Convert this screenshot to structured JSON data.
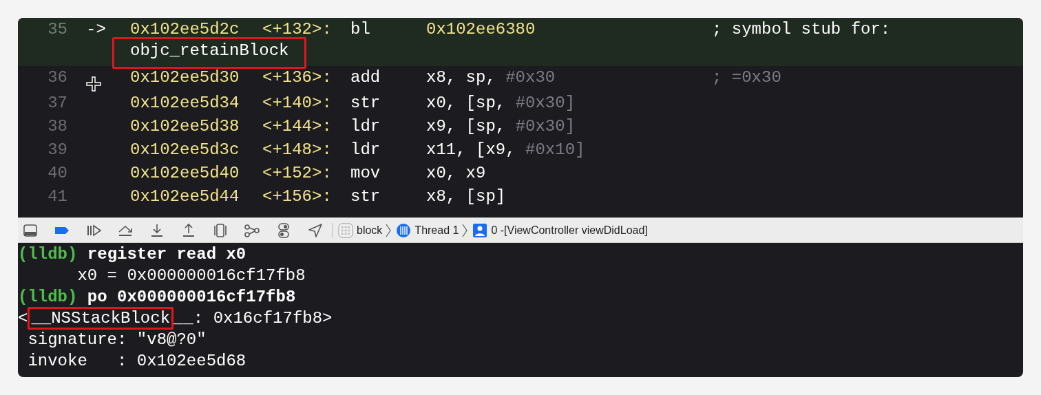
{
  "disassembly": {
    "rows": [
      {
        "line": "35",
        "current": true,
        "pc_arrow": "->",
        "address": "0x102ee5d2c",
        "offset": "<+132>:",
        "mnemonic": "bl",
        "kind": "call",
        "operands": "0x102ee6380",
        "operands_dim": "",
        "comment": "; symbol stub for:",
        "comment_continuation": {
          "text": "objc_retainBlock",
          "boxed": true
        }
      },
      {
        "line": "36",
        "current": false,
        "address": "0x102ee5d30",
        "offset": "<+136>:",
        "mnemonic": "add",
        "kind": "plain",
        "operands": "x8, sp, ",
        "operands_dim": "#0x30",
        "comment": "; =0x30"
      },
      {
        "line": "37",
        "current": false,
        "address": "0x102ee5d34",
        "offset": "<+140>:",
        "mnemonic": "str",
        "kind": "plain",
        "operands": "x0, [sp, ",
        "operands_dim": "#0x30]"
      },
      {
        "line": "38",
        "current": false,
        "address": "0x102ee5d38",
        "offset": "<+144>:",
        "mnemonic": "ldr",
        "kind": "plain",
        "operands": "x9, [sp, ",
        "operands_dim": "#0x30]"
      },
      {
        "line": "39",
        "current": false,
        "address": "0x102ee5d3c",
        "offset": "<+148>:",
        "mnemonic": "ldr",
        "kind": "plain",
        "operands": "x11, [x9, ",
        "operands_dim": "#0x10]"
      },
      {
        "line": "40",
        "current": false,
        "address": "0x102ee5d40",
        "offset": "<+152>:",
        "mnemonic": "mov",
        "kind": "plain",
        "operands": "x0, x9",
        "operands_dim": ""
      },
      {
        "line": "41",
        "current": false,
        "address": "0x102ee5d44",
        "offset": "<+156>:",
        "mnemonic": "str",
        "kind": "plain",
        "operands": "x8, [sp]",
        "operands_dim": ""
      }
    ]
  },
  "debug_bar": {
    "buttons": [
      {
        "kind": "panel"
      },
      {
        "kind": "breakpoints",
        "on": true
      },
      {
        "kind": "continue"
      },
      {
        "kind": "step_over"
      },
      {
        "kind": "step_into"
      },
      {
        "kind": "step_out"
      },
      {
        "kind": "view_debugger"
      },
      {
        "kind": "memory_graph"
      },
      {
        "kind": "environment"
      },
      {
        "kind": "location"
      }
    ],
    "breadcrumbs": [
      {
        "kind": "target",
        "label": "block"
      },
      {
        "kind": "thread",
        "label": "Thread 1"
      },
      {
        "kind": "frame",
        "label": "0 -[ViewController viewDidLoad]"
      }
    ]
  },
  "console": {
    "lines": [
      {
        "kind": "command",
        "prompt": "(lldb)",
        "text": "register read x0"
      },
      {
        "kind": "output",
        "segments": [
          {
            "text": "      x0 = 0x000000016cf17fb8"
          }
        ]
      },
      {
        "kind": "command",
        "prompt": "(lldb)",
        "text": "po 0x000000016cf17fb8"
      },
      {
        "kind": "output",
        "segments": [
          {
            "text": "<"
          },
          {
            "text": "__NSStackBlock",
            "boxed": true
          },
          {
            "text": "__: 0x16cf17fb8>"
          }
        ]
      },
      {
        "kind": "output",
        "segments": [
          {
            "text": " signature: \"v8@?0\""
          }
        ]
      },
      {
        "kind": "output",
        "segments": [
          {
            "text": " invoke   : 0x102ee5d68"
          }
        ]
      }
    ]
  }
}
